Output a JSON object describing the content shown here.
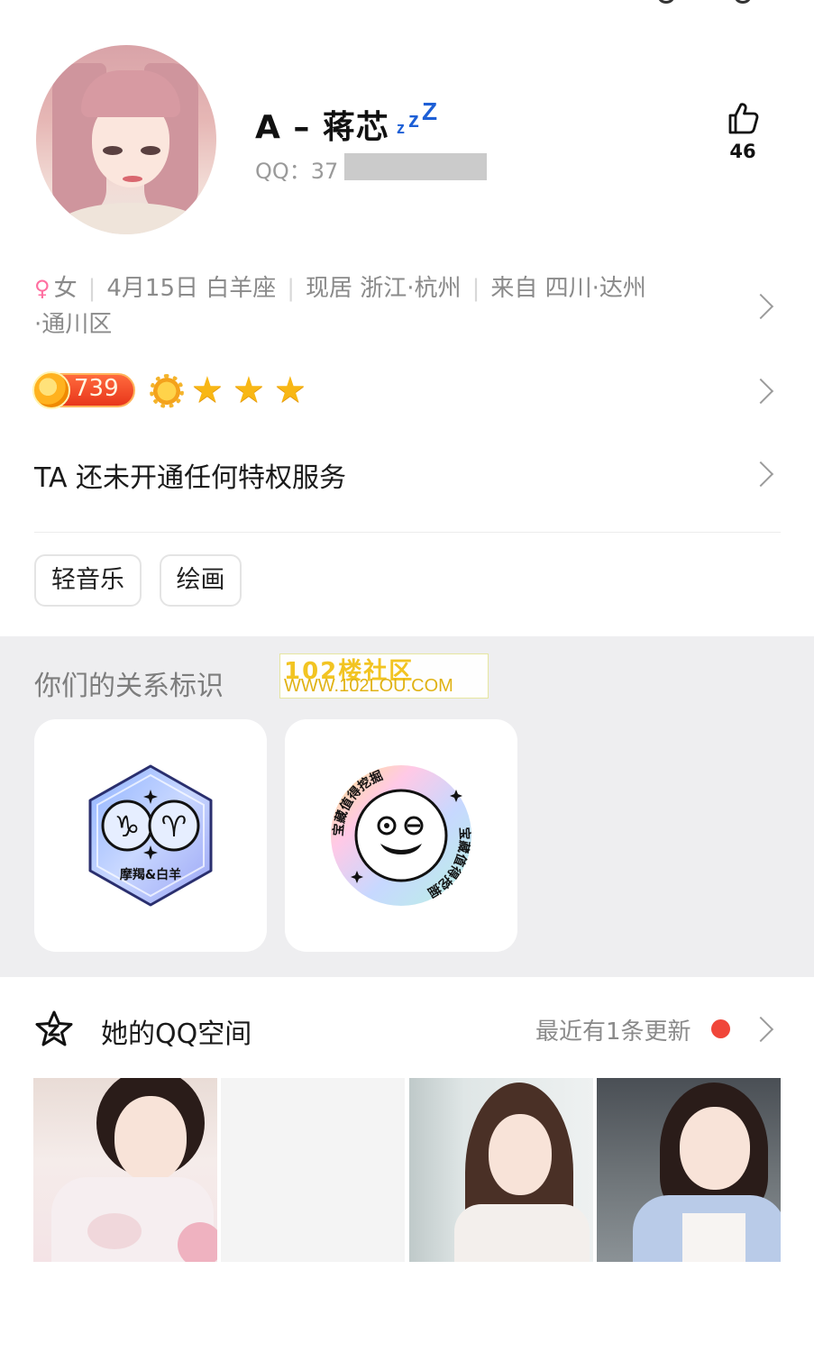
{
  "profile": {
    "nickname": "A – 蒋芯",
    "qq_label": "QQ：37",
    "likes": "46"
  },
  "info": {
    "gender": "女",
    "birthday": "4月15日 白羊座",
    "residence": "现居 浙江·杭州",
    "hometown": "来自 四川·达州",
    "district": "·通川区"
  },
  "level": {
    "value": "739",
    "icons": [
      "sun-icon",
      "star-icon",
      "star-icon",
      "star-icon"
    ]
  },
  "privilege": {
    "text": "TA 还未开通任何特权服务"
  },
  "tags": [
    "轻音乐",
    "绘画"
  ],
  "relationship": {
    "title": "你们的关系标识",
    "watermark": {
      "line1": "102楼社区",
      "line2": "WWW.102LOU.COM"
    },
    "badges": [
      {
        "label": "摩羯&白羊",
        "symbols": [
          "♑",
          "♈"
        ]
      },
      {
        "ring_text": "宝藏值得挖掘"
      }
    ]
  },
  "qzone": {
    "title": "她的QQ空间",
    "update_text": "最近有1条更新"
  },
  "colors": {
    "accent_blue": "#1d5fd6",
    "update_dot": "#f0463a",
    "section_bg": "#eeeef0",
    "female": "#ff6fa0"
  }
}
